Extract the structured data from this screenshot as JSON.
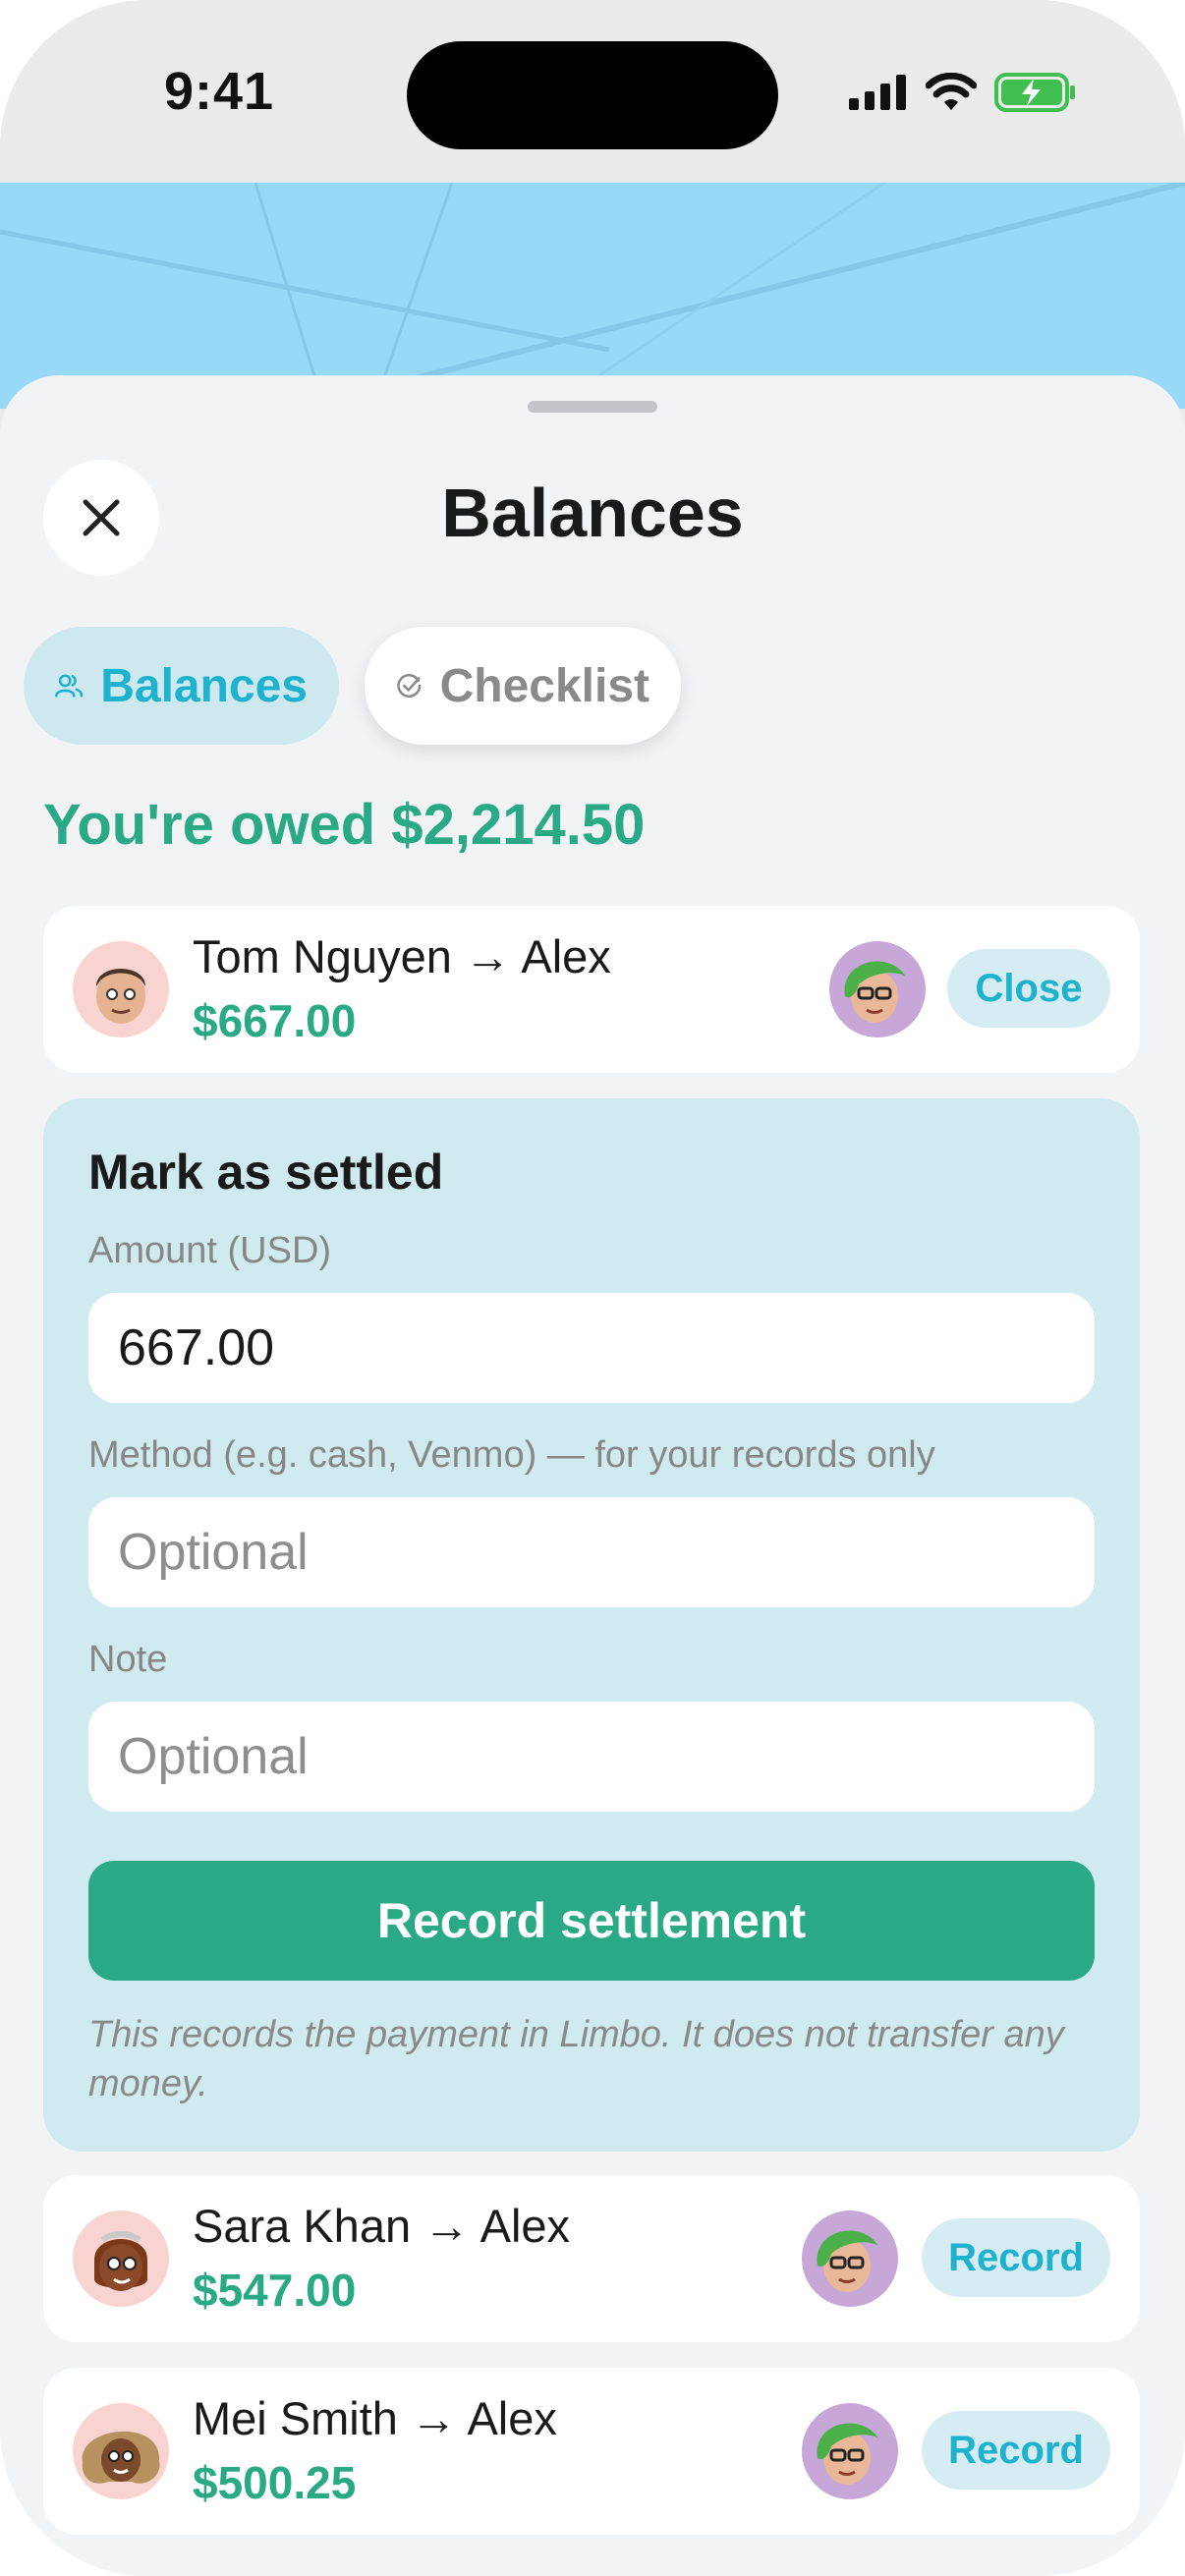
{
  "status_bar": {
    "time": "9:41"
  },
  "sheet": {
    "title": "Balances"
  },
  "tabs": [
    {
      "label": "Balances",
      "icon": "people-icon",
      "active": true
    },
    {
      "label": "Checklist",
      "icon": "check-circle-icon",
      "active": false
    }
  ],
  "summary": {
    "owed_text": "You're owed $2,214.50"
  },
  "rows": [
    {
      "name": "Tom Nguyen → Alex",
      "amount": "$667.00",
      "action": "Close"
    },
    {
      "name": "Sara Khan → Alex",
      "amount": "$547.00",
      "action": "Record"
    },
    {
      "name": "Mei Smith → Alex",
      "amount": "$500.25",
      "action": "Record"
    }
  ],
  "settle_form": {
    "title": "Mark as settled",
    "amount_label": "Amount (USD)",
    "amount_value": "667.00",
    "method_label": "Method (e.g. cash, Venmo) — for your records only",
    "method_placeholder": "Optional",
    "note_label": "Note",
    "note_placeholder": "Optional",
    "submit_label": "Record settlement",
    "disclaimer": "This records the payment in Limbo. It does not transfer any money."
  },
  "colors": {
    "accent_green": "#2aa987",
    "accent_cyan": "#1fb2cf",
    "card_tint": "#cfebef"
  }
}
